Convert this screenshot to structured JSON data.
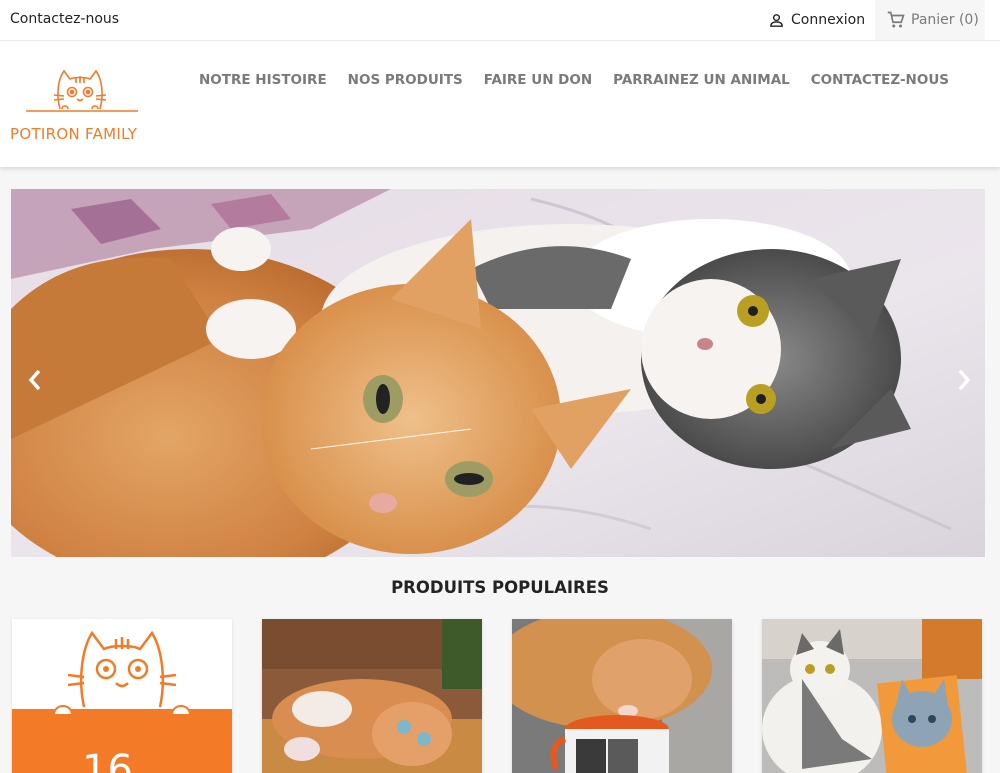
{
  "topbar": {
    "contact_label": "Contactez-nous",
    "login_label": "Connexion",
    "cart_label": "Panier (0)",
    "user_icon": "user-icon",
    "cart_icon": "cart-icon"
  },
  "brand": {
    "name": "POTIRON FAMILY",
    "accent_color": "#f37a26"
  },
  "nav": {
    "items": [
      {
        "label": "NOTRE HISTOIRE"
      },
      {
        "label": "NOS PRODUITS"
      },
      {
        "label": "FAIRE UN DON"
      },
      {
        "label": "PARRAINEZ UN ANIMAL"
      },
      {
        "label": "CONTACTEZ-NOUS"
      }
    ]
  },
  "carousel": {
    "prev_icon": "chevron-left-icon",
    "next_icon": "chevron-right-icon"
  },
  "popular": {
    "title": "PRODUITS POPULAIRES",
    "products": [
      {
        "partial_text": "16"
      },
      {
        "partial_text": ""
      },
      {
        "partial_text": ""
      },
      {
        "partial_text": ""
      }
    ]
  }
}
